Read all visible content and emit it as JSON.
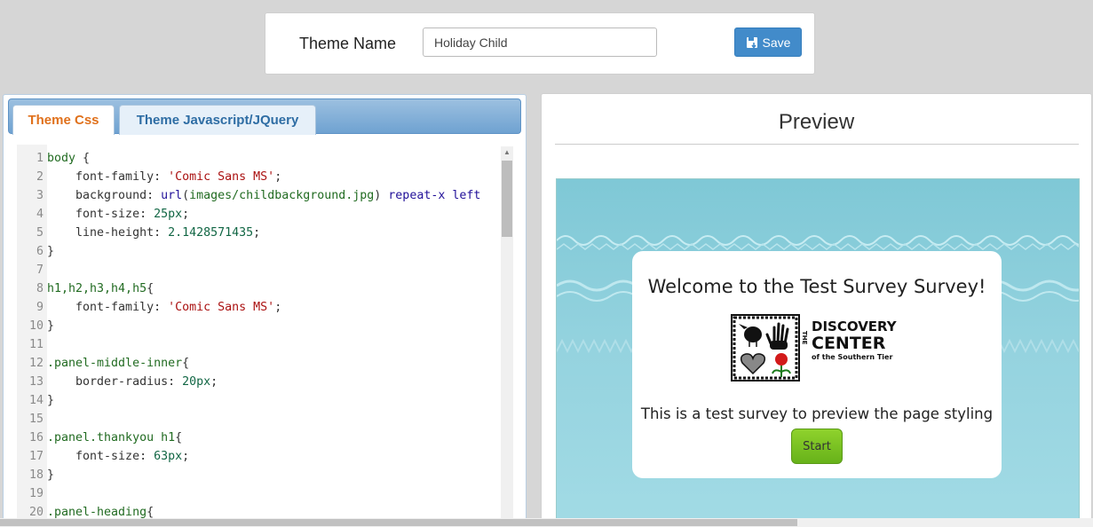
{
  "theme": {
    "label": "Theme Name",
    "value": "Holiday Child",
    "save_label": "Save"
  },
  "tabs": [
    {
      "label": "Theme Css",
      "active": true
    },
    {
      "label": "Theme Javascript/JQuery",
      "active": false
    }
  ],
  "editor": {
    "lines": [
      {
        "n": "1",
        "t": [
          [
            "sel",
            "body "
          ],
          [
            "prop",
            "{"
          ]
        ]
      },
      {
        "n": "2",
        "t": [
          [
            "prop",
            "    font-family: "
          ],
          [
            "str",
            "'Comic Sans MS'"
          ],
          [
            "prop",
            ";"
          ]
        ]
      },
      {
        "n": "3",
        "t": [
          [
            "prop",
            "    background: "
          ],
          [
            "kw",
            "url"
          ],
          [
            "prop",
            "("
          ],
          [
            "sel",
            "images/childbackground.jpg"
          ],
          [
            "prop",
            ") "
          ],
          [
            "kw",
            "repeat-x"
          ],
          [
            "prop",
            " "
          ],
          [
            "kw",
            "left"
          ]
        ]
      },
      {
        "n": "4",
        "t": [
          [
            "prop",
            "    font-size: "
          ],
          [
            "num",
            "25px"
          ],
          [
            "prop",
            ";"
          ]
        ]
      },
      {
        "n": "5",
        "t": [
          [
            "prop",
            "    line-height: "
          ],
          [
            "num",
            "2.1428571435"
          ],
          [
            "prop",
            ";"
          ]
        ]
      },
      {
        "n": "6",
        "t": [
          [
            "prop",
            "}"
          ]
        ]
      },
      {
        "n": "7",
        "t": []
      },
      {
        "n": "8",
        "t": [
          [
            "sel",
            "h1,h2,h3,h4,h5"
          ],
          [
            "prop",
            "{"
          ]
        ]
      },
      {
        "n": "9",
        "t": [
          [
            "prop",
            "    font-family: "
          ],
          [
            "str",
            "'Comic Sans MS'"
          ],
          [
            "prop",
            ";"
          ]
        ]
      },
      {
        "n": "10",
        "t": [
          [
            "prop",
            "}"
          ]
        ]
      },
      {
        "n": "11",
        "t": []
      },
      {
        "n": "12",
        "t": [
          [
            "sel",
            ".panel-middle-inner"
          ],
          [
            "prop",
            "{"
          ]
        ]
      },
      {
        "n": "13",
        "t": [
          [
            "prop",
            "    border-radius: "
          ],
          [
            "num",
            "20px"
          ],
          [
            "prop",
            ";"
          ]
        ]
      },
      {
        "n": "14",
        "t": [
          [
            "prop",
            "}"
          ]
        ]
      },
      {
        "n": "15",
        "t": []
      },
      {
        "n": "16",
        "t": [
          [
            "sel",
            ".panel.thankyou h1"
          ],
          [
            "prop",
            "{"
          ]
        ]
      },
      {
        "n": "17",
        "t": [
          [
            "prop",
            "    font-size: "
          ],
          [
            "num",
            "63px"
          ],
          [
            "prop",
            ";"
          ]
        ]
      },
      {
        "n": "18",
        "t": [
          [
            "prop",
            "}"
          ]
        ]
      },
      {
        "n": "19",
        "t": []
      },
      {
        "n": "20",
        "t": [
          [
            "sel",
            ".panel-heading"
          ],
          [
            "prop",
            "{"
          ]
        ]
      }
    ]
  },
  "preview": {
    "title": "Preview",
    "survey_title": "Welcome to the Test Survey Survey!",
    "description": "This is a test survey to preview the page styling",
    "start_label": "Start",
    "logo": {
      "line1_vertical": "THE",
      "line1": "DISCOVERY",
      "line2": "CENTER",
      "line3": "of the Southern Tier"
    }
  },
  "colors": {
    "save_button": "#428bca",
    "active_tab_text": "#e0711c",
    "inactive_tab_text": "#2e6da4",
    "start_button": "#7cc423",
    "preview_background": "#95d3df"
  },
  "icons": {
    "save": "floppy-download-icon"
  }
}
